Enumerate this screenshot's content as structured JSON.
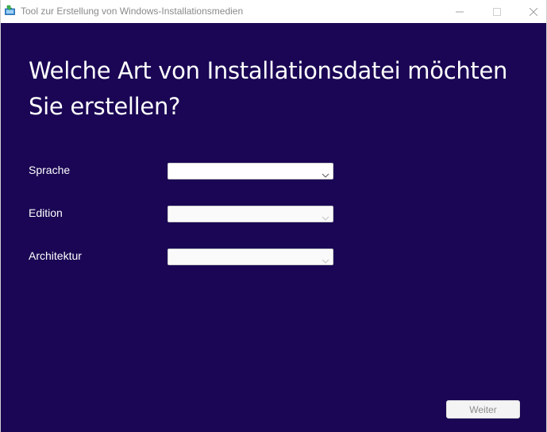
{
  "window": {
    "title": "Tool zur Erstellung von Windows-Installationsmedien",
    "icon": "media-creation-tool-icon",
    "controls": [
      "minimize-icon",
      "maximize-icon",
      "close-icon"
    ]
  },
  "main": {
    "heading": "Welche Art von Installationsdatei möchten Sie erstellen?",
    "fields": [
      {
        "label": "Sprache",
        "value": "",
        "enabled": true
      },
      {
        "label": "Edition",
        "value": "",
        "enabled": false
      },
      {
        "label": "Architektur",
        "value": "",
        "enabled": false
      }
    ]
  },
  "footer": {
    "next_label": "Weiter",
    "next_enabled": false
  },
  "colors": {
    "content_background": "#1a0654",
    "text": "#ffffff",
    "title_text": "#8a8a8a"
  }
}
